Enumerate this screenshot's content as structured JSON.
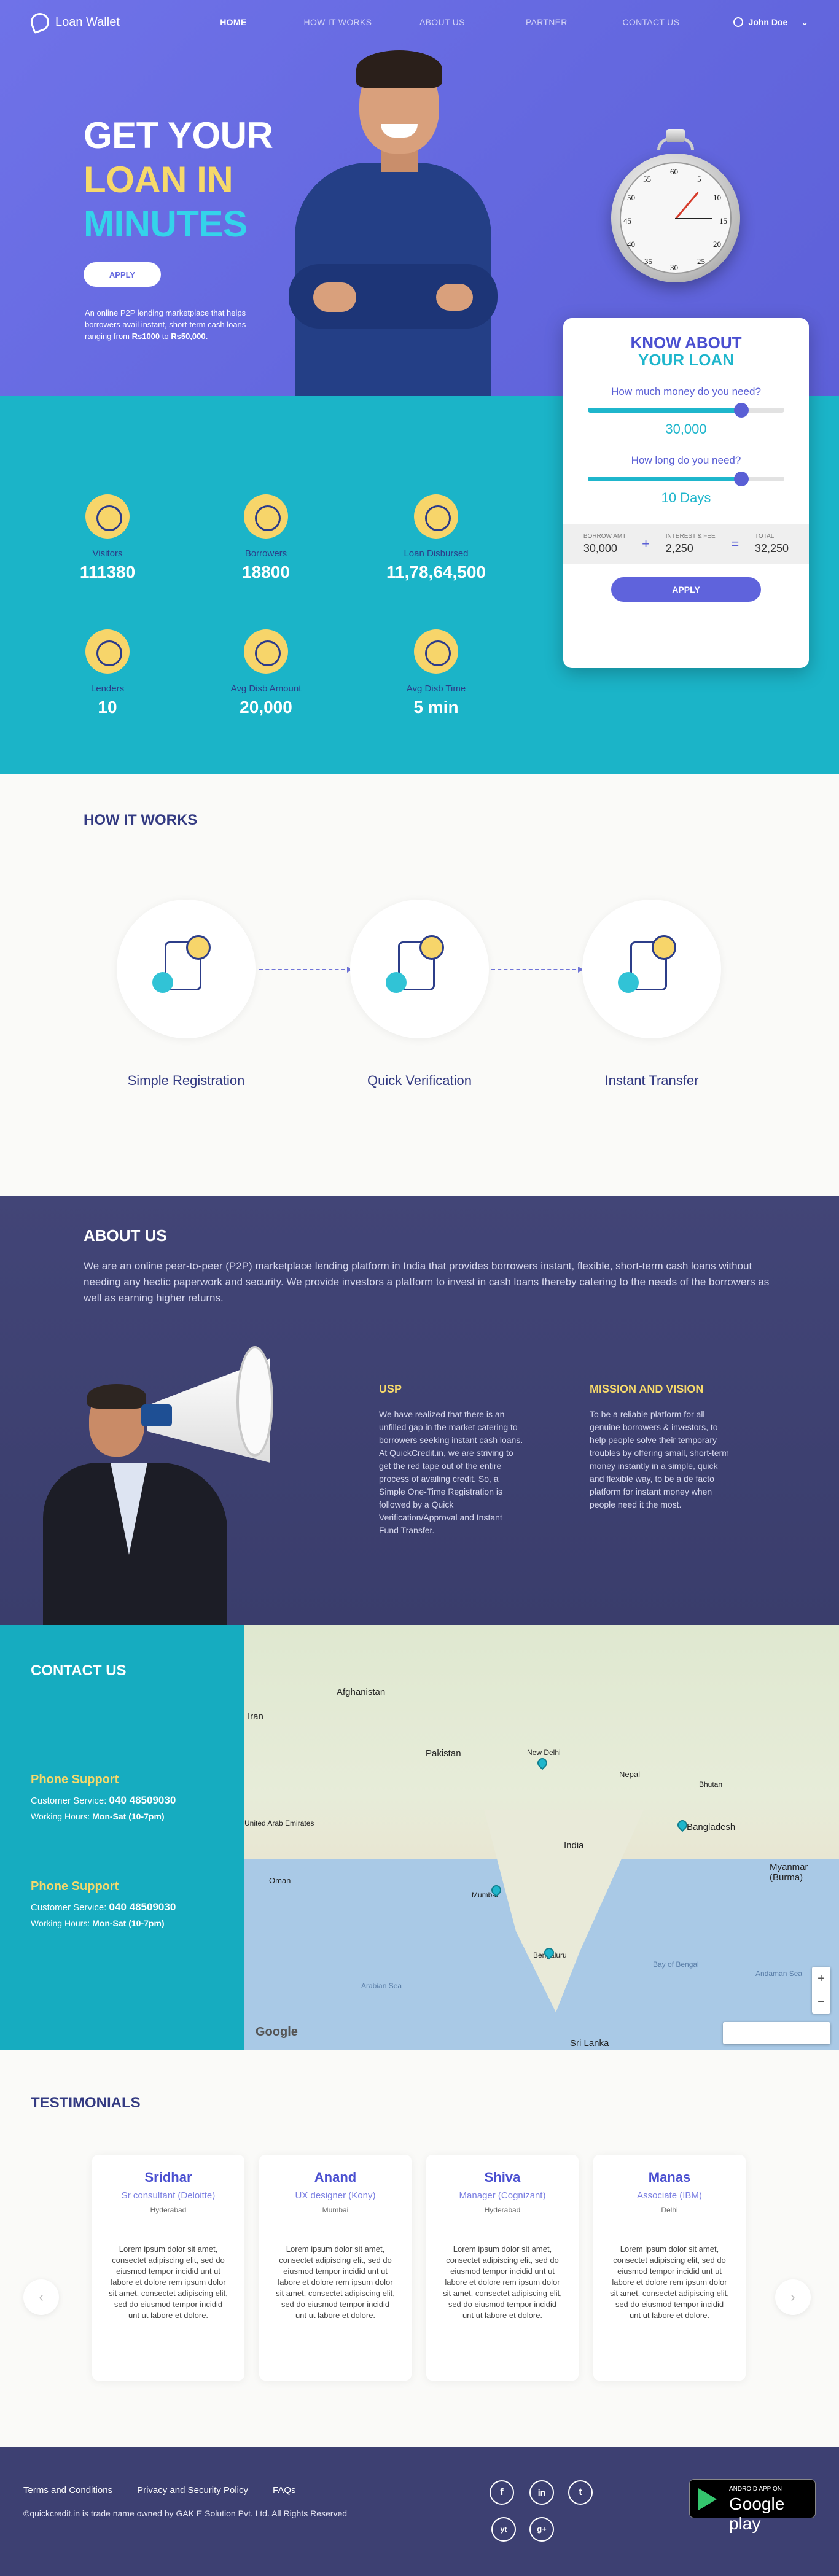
{
  "nav": {
    "logo": "Loan Wallet",
    "links": [
      "HOME",
      "HOW IT WORKS",
      "ABOUT US",
      "PARTNER",
      "CONTACT US"
    ],
    "user": "John Doe"
  },
  "hero": {
    "line1": "GET YOUR",
    "line2": "LOAN IN",
    "line3": "MINUTES",
    "apply": "APPLY",
    "desc_start": "An online P2P lending marketplace that helps borrowers avail instant, short-term cash loans ranging from ",
    "amt_min": "Rs1000",
    "desc_mid": " to ",
    "amt_max": "Rs50,000."
  },
  "stopwatch": {
    "numbers": [
      "60",
      "5",
      "10",
      "15",
      "20",
      "25",
      "30",
      "35",
      "40",
      "45",
      "50",
      "55"
    ]
  },
  "loan_card": {
    "title1": "KNOW ABOUT",
    "title2": "YOUR LOAN",
    "money_q": "How much money do you need?",
    "money_val": "30,000",
    "money_level": 0.78,
    "days_q": "How long do you need?",
    "days_val": "10 Days",
    "days_level": 0.78,
    "borrow_label": "BORROW AMT",
    "borrow_amt": "30,000",
    "fee_label": "INTEREST & FEE",
    "fee_amt": "2,250",
    "total_label": "TOTAL",
    "total_amt": "32,250",
    "plus": "+",
    "equals": "=",
    "apply": "APPLY"
  },
  "stats": [
    {
      "label": "Visitors",
      "value": "111380"
    },
    {
      "label": "Borrowers",
      "value": "18800"
    },
    {
      "label": "Loan Disbursed",
      "value": "11,78,64,500"
    },
    {
      "label": "Lenders",
      "value": "10"
    },
    {
      "label": "Avg Disb Amount",
      "value": "20,000"
    },
    {
      "label": "Avg Disb Time",
      "value": "5 min"
    }
  ],
  "how": {
    "title": "HOW IT WORKS",
    "steps": [
      "Simple Registration",
      "Quick Verification",
      "Instant Transfer"
    ]
  },
  "about": {
    "title": "ABOUT US",
    "intro": "We are an online peer-to-peer (P2P) marketplace lending platform in India that provides borrowers instant, flexible, short-term cash loans without needing any hectic paperwork and security. We provide investors a platform to invest in cash loans thereby catering to the needs of the borrowers as well as earning higher returns.",
    "usp_title": "USP",
    "usp_text": "We have realized that there is an unfilled gap in the market catering to borrowers seeking instant cash loans. At QuickCredit.in, we are striving to get the red tape out of the entire process of availing credit. So, a Simple One-Time Registration is followed by a Quick Verification/Approval and Instant Fund Transfer.",
    "mission_title": "MISSION AND VISION",
    "mission_text": "To be a reliable platform for all genuine borrowers & investors, to help people solve their temporary troubles by offering small, short-term money instantly in a simple, quick and flexible way, to be a de facto platform for instant money when people need it the most."
  },
  "contact": {
    "title": "CONTACT US",
    "blocks": [
      {
        "title": "Phone Support",
        "service_label": "Customer Service: ",
        "phone": "040 48509030",
        "hours_label": "Working Hours: ",
        "hours": "Mon-Sat (10-7pm)"
      },
      {
        "title": "Phone Support",
        "service_label": "Customer Service: ",
        "phone": "040 48509030",
        "hours_label": "Working Hours: ",
        "hours": "Mon-Sat (10-7pm)"
      }
    ]
  },
  "map": {
    "labels": [
      "Afghanistan",
      "Iran",
      "Pakistan",
      "New Delhi",
      "Nepal",
      "Bhutan",
      "India",
      "Bangladesh",
      "Myanmar (Burma)",
      "United Arab Emirates",
      "Oman",
      "Mumbai",
      "Bengaluru",
      "Arabian Sea",
      "Bay of Bengal",
      "Sri Lanka",
      "Andaman Sea"
    ],
    "google": "Google",
    "zoom_in": "+",
    "zoom_out": "−"
  },
  "testimonials": {
    "title": "TESTIMONIALS",
    "prev": "‹",
    "next": "›",
    "items": [
      {
        "name": "Sridhar",
        "role": "Sr consultant (Deloitte)",
        "city": "Hyderabad",
        "text": "Lorem ipsum dolor sit amet, consectet adipiscing elit, sed do eiusmod tempor incidid unt ut labore et dolore rem ipsum dolor sit amet, consectet adipiscing elit, sed do eiusmod tempor incidid unt ut labore et dolore."
      },
      {
        "name": "Anand",
        "role": "UX designer (Kony)",
        "city": "Mumbai",
        "text": "Lorem ipsum dolor sit amet, consectet adipiscing elit, sed do eiusmod tempor incidid unt ut labore et dolore rem ipsum dolor sit amet, consectet adipiscing elit, sed do eiusmod tempor incidid unt ut labore et dolore."
      },
      {
        "name": "Shiva",
        "role": "Manager (Cognizant)",
        "city": "Hyderabad",
        "text": "Lorem ipsum dolor sit amet, consectet adipiscing elit, sed do eiusmod tempor incidid unt ut labore et dolore rem ipsum dolor sit amet, consectet adipiscing elit, sed do eiusmod tempor incidid unt ut labore et dolore."
      },
      {
        "name": "Manas",
        "role": "Associate (IBM)",
        "city": "Delhi",
        "text": "Lorem ipsum dolor sit amet, consectet adipiscing elit, sed do eiusmod tempor incidid unt ut labore et dolore rem ipsum dolor sit amet, consectet adipiscing elit, sed do eiusmod tempor incidid unt ut labore et dolore."
      }
    ]
  },
  "footer": {
    "links": [
      "Terms and Conditions",
      "Privacy and Security Policy",
      "FAQs"
    ],
    "copyright": "©quickcredit.in is trade name owned by GAK E Solution Pvt. Ltd. All Rights Reserved",
    "social_glyphs": [
      "f",
      "in",
      "t",
      "yt",
      "g+"
    ],
    "store_small": "ANDROID APP ON",
    "store_big": "Google play"
  },
  "colors": {
    "hero": "#6468df",
    "accent_cyan": "#1bb4c8",
    "accent_yellow": "#f6d96b",
    "navy": "#3d4072"
  }
}
